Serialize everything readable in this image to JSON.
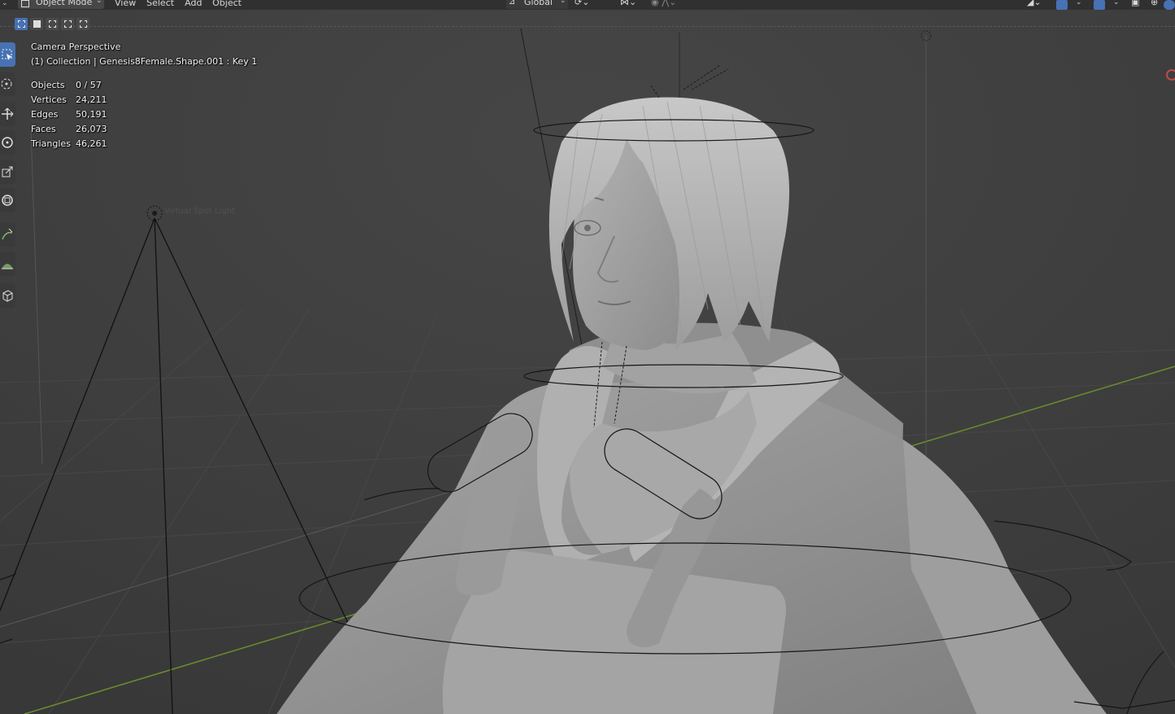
{
  "header": {
    "mode_label": "Object Mode",
    "menu": [
      "View",
      "Select",
      "Add",
      "Object"
    ],
    "orientation_label": "Global"
  },
  "overlay": {
    "view_name": "Camera Perspective",
    "collection_info": "(1) Collection | Genesis8Female.Shape.001 : Key 1",
    "stats": [
      {
        "label": "Objects",
        "value": "0 / 57"
      },
      {
        "label": "Vertices",
        "value": "24,211"
      },
      {
        "label": "Edges",
        "value": "50,191"
      },
      {
        "label": "Faces",
        "value": "26,073"
      },
      {
        "label": "Triangles",
        "value": "46,261"
      }
    ],
    "light_name": "Virtual Spot Light"
  },
  "toolbar": {
    "tools": [
      "select-box-tool",
      "cursor-tool",
      "move-tool",
      "rotate-tool",
      "scale-tool",
      "transform-tool",
      "annotate-tool",
      "measure-tool",
      "add-cube-tool"
    ],
    "active_tool": "select-box-tool"
  },
  "colors": {
    "viewport_bg": "#3d3d3d",
    "header_bg": "#303030",
    "active_blue": "#4772b3",
    "x_axis": "#8b3a3a",
    "y_axis": "#6a8e2e",
    "model": "#9a9a9a"
  }
}
